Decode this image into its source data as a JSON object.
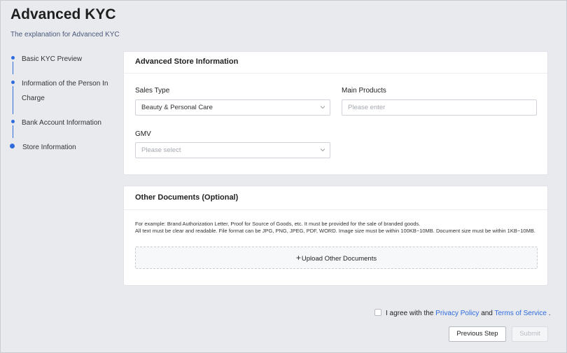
{
  "header": {
    "title": "Advanced KYC",
    "subtitle": "The explanation for Advanced KYC"
  },
  "steps": [
    {
      "label_line1": "Basic KYC Preview",
      "label_line2": ""
    },
    {
      "label_line1": "Information of the Person In",
      "label_line2": "Charge"
    },
    {
      "label_line1": "Bank Account Information",
      "label_line2": ""
    },
    {
      "label_line1": "Store Information",
      "label_line2": "",
      "current": true
    }
  ],
  "store_card": {
    "title": "Advanced Store Information",
    "sales_type": {
      "label": "Sales Type",
      "value": "Beauty & Personal Care"
    },
    "main_products": {
      "label": "Main Products",
      "placeholder": "Please enter"
    },
    "gmv": {
      "label": "GMV",
      "placeholder": "Please select"
    }
  },
  "docs_card": {
    "title": "Other Documents (Optional)",
    "hint_line1": "For example: Brand Authorization Letter, Proof for Source of Goods, etc. It must be provided for the sale of branded goods.",
    "hint_line2": "All text must be clear and readable. File format can be JPG, PNG, JPEG, PDF, WORD. Image size must be within 100KB~10MB. Document size must be within 1KB~10MB.",
    "upload_plus": "+",
    "upload_label": "Upload Other Documents"
  },
  "agreement": {
    "prefix": "I agree with the",
    "privacy_link": "Privacy Policy",
    "and": "and",
    "terms_link": "Terms of Service",
    "suffix": "."
  },
  "actions": {
    "previous_label": "Previous Step",
    "submit_label": "Submit"
  },
  "colors": {
    "accent": "#2f6bdc",
    "background": "#e8eaee",
    "card": "#ffffff"
  }
}
